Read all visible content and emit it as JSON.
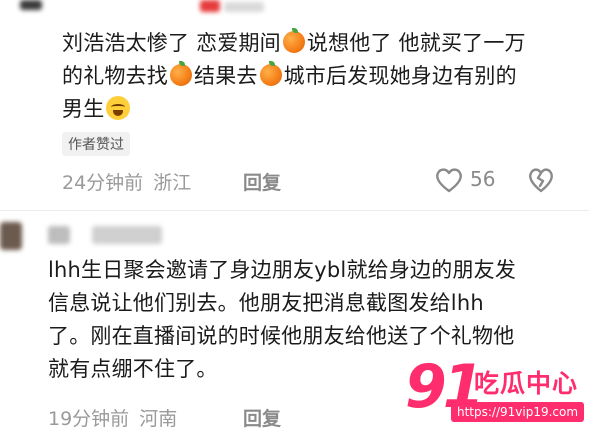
{
  "comments": [
    {
      "lines": [
        "刘浩浩太惨了 恋爱期间",
        "说想他了 他就买了一万",
        "的礼物去找",
        "结果去",
        "城市后发现她身边有别的",
        "男生"
      ],
      "badge": "作者赞过",
      "time": "24分钟前",
      "location": "浙江",
      "reply_label": "回复",
      "likes": "56"
    },
    {
      "lines": [
        "lhh生日聚会邀请了身边朋友ybl就给身边的朋友发",
        "信息说让他们别去。他朋友把消息截图发给lhh",
        "了。刚在直播间说的时候他朋友给他送了个礼物他",
        "就有点绷不住了。"
      ],
      "time": "19分钟前",
      "location": "河南",
      "reply_label": "回复"
    }
  ],
  "icons": {
    "like": "heart-outline-icon",
    "dislike": "broken-heart-icon",
    "emoji_orange": "orange-emoji-icon",
    "emoji_cry": "crying-face-emoji-icon"
  },
  "watermark": {
    "number": "91",
    "title": "吃瓜中心",
    "url": "https://91vip19.com"
  },
  "colors": {
    "meta": "#9a9a9a",
    "watermark": "#ff2d6d"
  }
}
